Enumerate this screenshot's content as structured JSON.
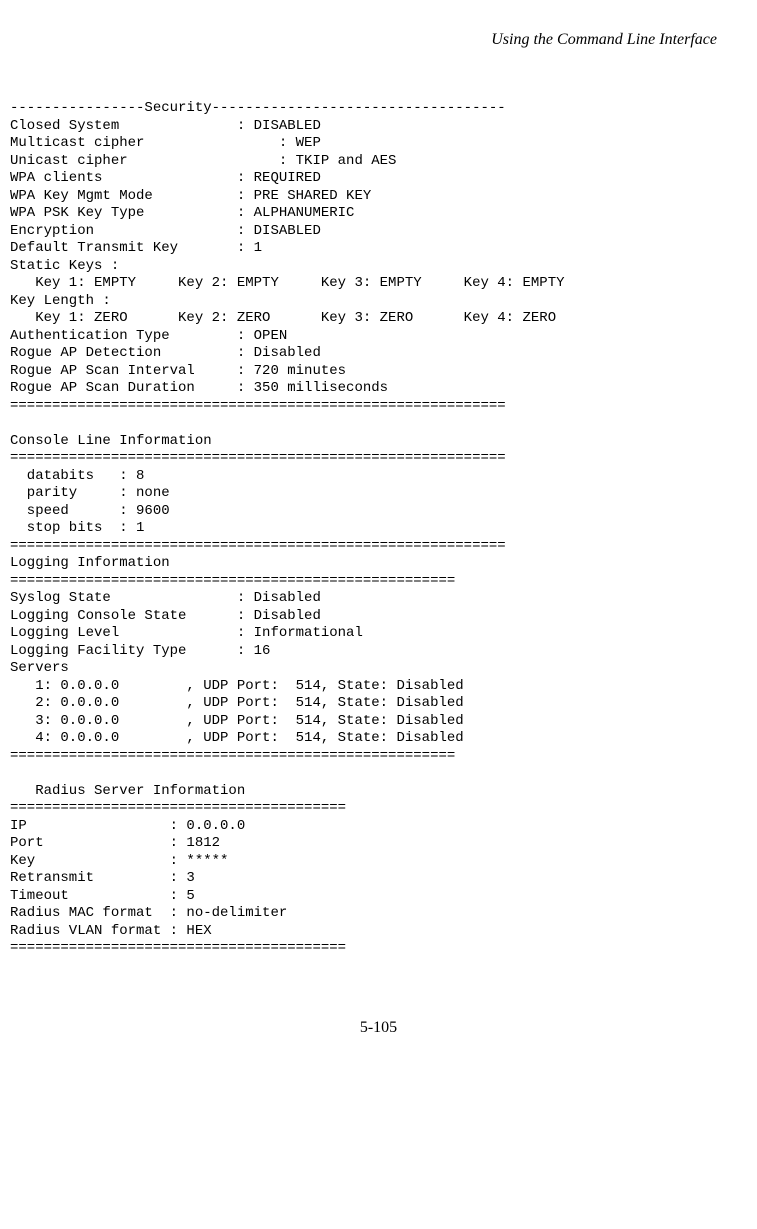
{
  "header": "Using the Command Line Interface",
  "footer": "5-105",
  "lines": {
    "l0": "----------------Security-----------------------------------",
    "l1": "Closed System              : DISABLED",
    "l2": "Multicast cipher                : WEP",
    "l3": "Unicast cipher                  : TKIP and AES",
    "l4": "WPA clients                : REQUIRED",
    "l5": "WPA Key Mgmt Mode          : PRE SHARED KEY",
    "l6": "WPA PSK Key Type           : ALPHANUMERIC",
    "l7": "Encryption                 : DISABLED",
    "l8": "Default Transmit Key       : 1",
    "l9": "Static Keys : ",
    "l10": "   Key 1: EMPTY     Key 2: EMPTY     Key 3: EMPTY     Key 4: EMPTY  ",
    "l11": "Key Length : ",
    "l12": "   Key 1: ZERO      Key 2: ZERO      Key 3: ZERO      Key 4: ZERO  ",
    "l13": "Authentication Type        : OPEN",
    "l14": "Rogue AP Detection         : Disabled",
    "l15": "Rogue AP Scan Interval     : 720 minutes",
    "l16": "Rogue AP Scan Duration     : 350 milliseconds",
    "l17": "===========================================================",
    "l18": "",
    "l19": "Console Line Information",
    "l20": "===========================================================",
    "l21": "  databits   : 8",
    "l22": "  parity     : none",
    "l23": "  speed      : 9600",
    "l24": "  stop bits  : 1",
    "l25": "===========================================================",
    "l26": "Logging Information",
    "l27": "=====================================================",
    "l28": "Syslog State               : Disabled",
    "l29": "Logging Console State      : Disabled",
    "l30": "Logging Level              : Informational",
    "l31": "Logging Facility Type      : 16",
    "l32": "Servers",
    "l33": "   1: 0.0.0.0        , UDP Port:  514, State: Disabled",
    "l34": "   2: 0.0.0.0        , UDP Port:  514, State: Disabled",
    "l35": "   3: 0.0.0.0        , UDP Port:  514, State: Disabled",
    "l36": "   4: 0.0.0.0        , UDP Port:  514, State: Disabled",
    "l37": "=====================================================",
    "l38": "",
    "l39": "   Radius Server Information",
    "l40": "========================================",
    "l41": "IP                 : 0.0.0.0",
    "l42": "Port               : 1812",
    "l43": "Key                : *****",
    "l44": "Retransmit         : 3",
    "l45": "Timeout            : 5",
    "l46": "Radius MAC format  : no-delimiter",
    "l47": "Radius VLAN format : HEX",
    "l48": "========================================"
  }
}
